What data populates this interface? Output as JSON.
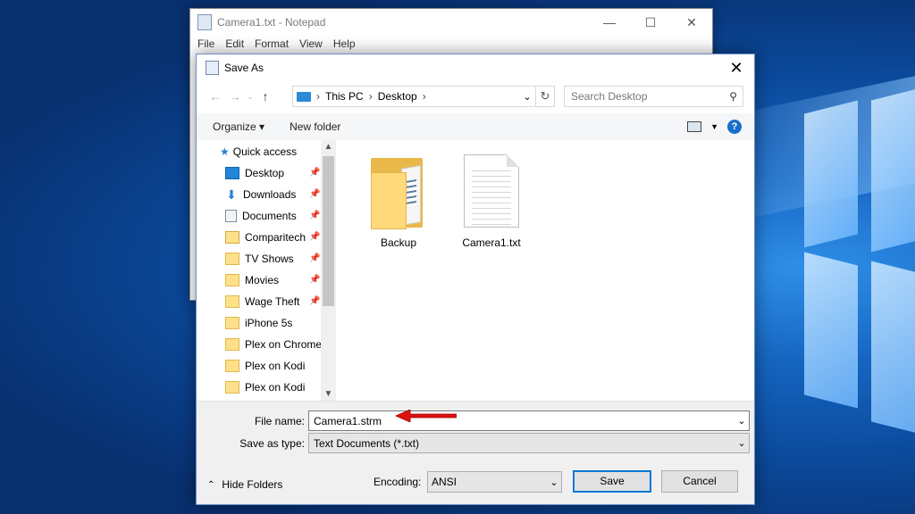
{
  "notepad": {
    "title": "Camera1.txt - Notepad",
    "menu": [
      "File",
      "Edit",
      "Format",
      "View",
      "Help"
    ],
    "controls": {
      "minimize": "—",
      "maximize": "☐",
      "close": "✕"
    }
  },
  "dialog": {
    "title": "Save As",
    "close": "✕",
    "address": {
      "crumbs": [
        "This PC",
        "Desktop"
      ],
      "sep": "›"
    },
    "search_placeholder": "Search Desktop",
    "toolbar": {
      "organize": "Organize ▾",
      "new_folder": "New folder"
    },
    "nav": {
      "quick_access": "Quick access",
      "items": [
        "Desktop",
        "Downloads",
        "Documents",
        "Comparitech",
        "TV Shows",
        "Movies",
        "Wage Theft",
        "iPhone 5s",
        "Plex on Chromecast",
        "Plex on Kodi",
        "Plex on Kodi"
      ]
    },
    "files": [
      {
        "name": "Backup",
        "kind": "folder"
      },
      {
        "name": "Camera1.txt",
        "kind": "text-file"
      }
    ],
    "file_name_label": "File name:",
    "file_name_value": "Camera1.strm",
    "save_type_label": "Save as type:",
    "save_type_value": "Text Documents (*.txt)",
    "hide_folders": "Hide Folders",
    "encoding_label": "Encoding:",
    "encoding_value": "ANSI",
    "save_label": "Save",
    "cancel_label": "Cancel"
  },
  "colors": {
    "accent": "#0078d7",
    "annotation_arrow": "#e01010"
  }
}
